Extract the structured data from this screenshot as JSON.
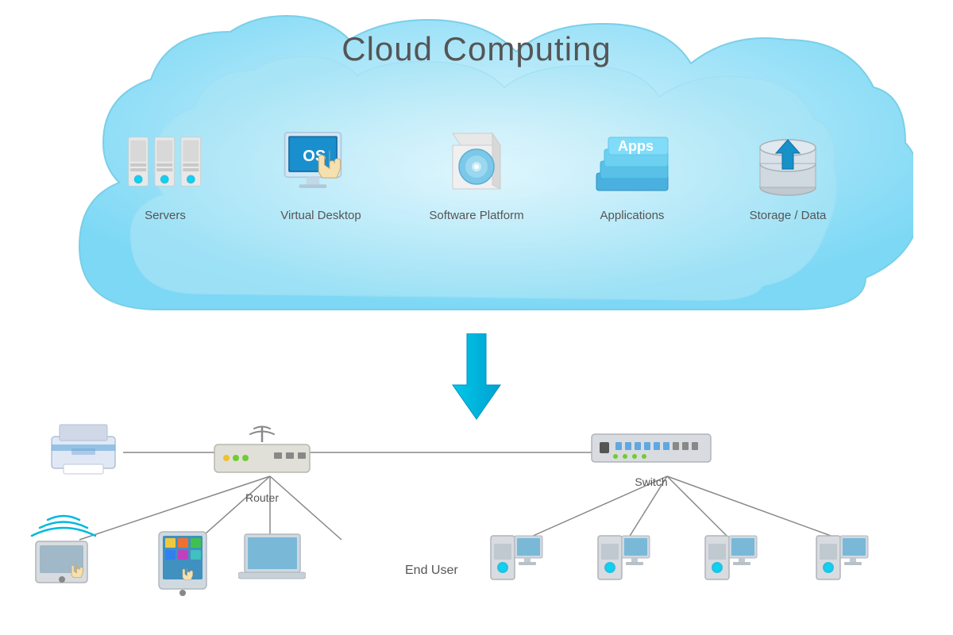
{
  "title": "Cloud Computing",
  "cloud_items": [
    {
      "id": "servers",
      "label": "Servers"
    },
    {
      "id": "virtual-desktop",
      "label": "Virtual Desktop"
    },
    {
      "id": "software-platform",
      "label": "Software Platform"
    },
    {
      "id": "applications",
      "label": "Applications"
    },
    {
      "id": "storage-data",
      "label": "Storage / Data"
    }
  ],
  "network_devices": [
    {
      "id": "printer",
      "label": ""
    },
    {
      "id": "tablet-wireless",
      "label": ""
    },
    {
      "id": "router",
      "label": "Router"
    },
    {
      "id": "tablet-touch",
      "label": ""
    },
    {
      "id": "laptop",
      "label": ""
    },
    {
      "id": "switch",
      "label": "Switch"
    },
    {
      "id": "end-user",
      "label": "End User"
    },
    {
      "id": "desktop1",
      "label": ""
    },
    {
      "id": "desktop2",
      "label": ""
    },
    {
      "id": "desktop3",
      "label": ""
    }
  ],
  "colors": {
    "cloud_fill": "#b8e8f8",
    "cloud_inner": "#cef0fc",
    "blue_accent": "#00b8e0",
    "arrow": "#00b8d9",
    "server_gray": "#d0d0d0",
    "text_dark": "#555555"
  }
}
